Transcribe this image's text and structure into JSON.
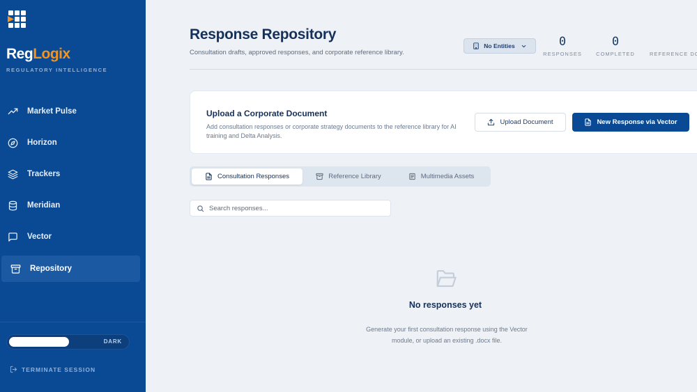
{
  "brand": {
    "name_part1": "Reg",
    "name_part2": "Logix",
    "tagline": "REGULATORY INTELLIGENCE",
    "accent_color": "#f4931f",
    "primary_color": "#0a4a94"
  },
  "sidebar": {
    "items": [
      {
        "label": "Market Pulse",
        "icon": "trending-up-icon"
      },
      {
        "label": "Horizon",
        "icon": "compass-icon"
      },
      {
        "label": "Trackers",
        "icon": "layers-icon"
      },
      {
        "label": "Meridian",
        "icon": "database-icon"
      },
      {
        "label": "Vector",
        "icon": "message-square-icon"
      },
      {
        "label": "Repository",
        "icon": "archive-icon",
        "active": true
      }
    ],
    "theme_toggle_label": "DARK",
    "terminate_label": "TERMINATE SESSION"
  },
  "header": {
    "title": "Response Repository",
    "subtitle": "Consultation drafts, approved responses, and corporate reference library.",
    "entities_selector": "No Entities",
    "stats": [
      {
        "value": "0",
        "label": "RESPONSES"
      },
      {
        "value": "0",
        "label": "COMPLETED"
      },
      {
        "value": "",
        "label": "REFERENCE DO"
      }
    ]
  },
  "upload_card": {
    "title": "Upload a Corporate Document",
    "description": "Add consultation responses or corporate strategy documents to the reference library for AI training and Delta Analysis.",
    "upload_button": "Upload Document",
    "new_button": "New Response via Vector"
  },
  "tabs": [
    {
      "label": "Consultation Responses",
      "icon": "file-text-icon",
      "active": true
    },
    {
      "label": "Reference Library",
      "icon": "archive-icon"
    },
    {
      "label": "Multimedia Assets",
      "icon": "file-stack-icon"
    }
  ],
  "search": {
    "placeholder": "Search responses..."
  },
  "empty_state": {
    "icon": "folder-open-icon",
    "title": "No responses yet",
    "description": "Generate your first consultation response using the Vector module, or upload an existing .docx file."
  }
}
